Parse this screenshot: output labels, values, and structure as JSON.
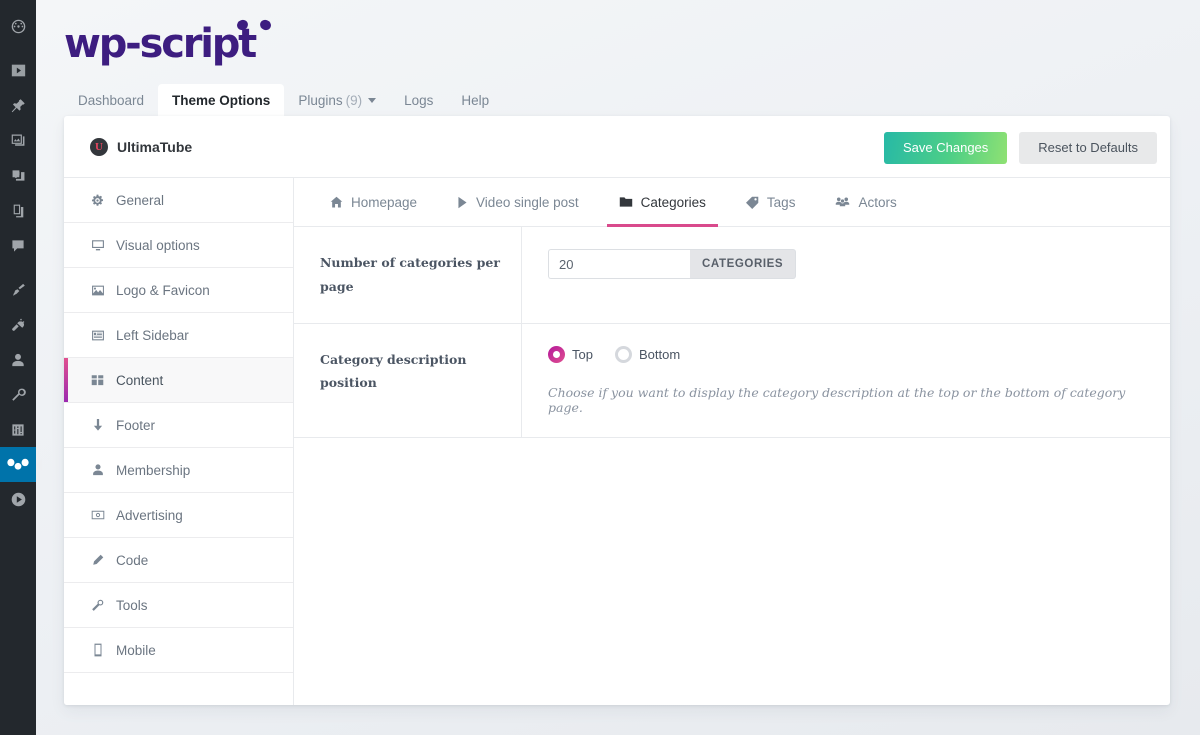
{
  "admin_rail": {
    "items": [
      {
        "name": "dashboard-icon",
        "active": false
      },
      {
        "name": "videos-icon",
        "active": false
      },
      {
        "name": "pin-icon",
        "active": false
      },
      {
        "name": "media-icon",
        "active": false
      },
      {
        "name": "photo-music-icon",
        "active": false
      },
      {
        "name": "pages-icon",
        "active": false
      },
      {
        "name": "comments-icon",
        "active": false
      },
      {
        "name": "brush-icon",
        "active": false
      },
      {
        "name": "plugin-icon",
        "active": false
      },
      {
        "name": "user-icon",
        "active": false
      },
      {
        "name": "tools-icon",
        "active": false
      },
      {
        "name": "settings-icon",
        "active": false
      },
      {
        "name": "wp-script-panda-icon",
        "active": true
      },
      {
        "name": "media-player-icon",
        "active": false
      }
    ]
  },
  "brand": {
    "logo_text": "wp-script",
    "logo_color": "#3d1d80"
  },
  "nav_tabs": [
    {
      "label": "Dashboard",
      "count": "",
      "active": false,
      "has_caret": false
    },
    {
      "label": "Theme Options",
      "count": "",
      "active": true,
      "has_caret": false
    },
    {
      "label": "Plugins",
      "count": "(9)",
      "active": false,
      "has_caret": true
    },
    {
      "label": "Logs",
      "count": "",
      "active": false,
      "has_caret": false
    },
    {
      "label": "Help",
      "count": "",
      "active": false,
      "has_caret": false
    }
  ],
  "card_header": {
    "theme_badge": "U",
    "theme_name": "UltimaTube",
    "save_label": "Save Changes",
    "reset_label": "Reset to Defaults",
    "save_gradient_from": "#27b9a6",
    "save_gradient_to": "#8fe173"
  },
  "option_menu": {
    "items": [
      {
        "label": "General",
        "icon": "gear-icon",
        "active": false
      },
      {
        "label": "Visual options",
        "icon": "monitor-icon",
        "active": false
      },
      {
        "label": "Logo & Favicon",
        "icon": "image-icon",
        "active": false
      },
      {
        "label": "Left Sidebar",
        "icon": "sidebar-icon",
        "active": false
      },
      {
        "label": "Content",
        "icon": "grid-icon",
        "active": true
      },
      {
        "label": "Footer",
        "icon": "arrow-down-icon",
        "active": false
      },
      {
        "label": "Membership",
        "icon": "user-icon",
        "active": false
      },
      {
        "label": "Advertising",
        "icon": "banknote-icon",
        "active": false
      },
      {
        "label": "Code",
        "icon": "pencil-icon",
        "active": false
      },
      {
        "label": "Tools",
        "icon": "wrench-icon",
        "active": false
      },
      {
        "label": "Mobile",
        "icon": "smartphone-icon",
        "active": false
      }
    ],
    "active_border_from": "#e0508f",
    "active_border_to": "#9c2ab0"
  },
  "sub_tabs": [
    {
      "label": "Homepage",
      "icon": "home-icon",
      "active": false
    },
    {
      "label": "Video single post",
      "icon": "play-icon",
      "active": false
    },
    {
      "label": "Categories",
      "icon": "folder-icon",
      "active": true
    },
    {
      "label": "Tags",
      "icon": "tag-icon",
      "active": false
    },
    {
      "label": "Actors",
      "icon": "users-icon",
      "active": false
    }
  ],
  "active_tab_underline": "#d94a8c",
  "form": {
    "rows": [
      {
        "label": "Number of categories per page",
        "type": "number-with-addon",
        "value": "20",
        "addon": "CATEGORIES"
      },
      {
        "label": "Category description position",
        "type": "radio",
        "options": [
          {
            "label": "Top",
            "selected": true
          },
          {
            "label": "Bottom",
            "selected": false
          }
        ],
        "help": "Choose if you want to display the category description at the top or the bottom of category page."
      }
    ]
  }
}
